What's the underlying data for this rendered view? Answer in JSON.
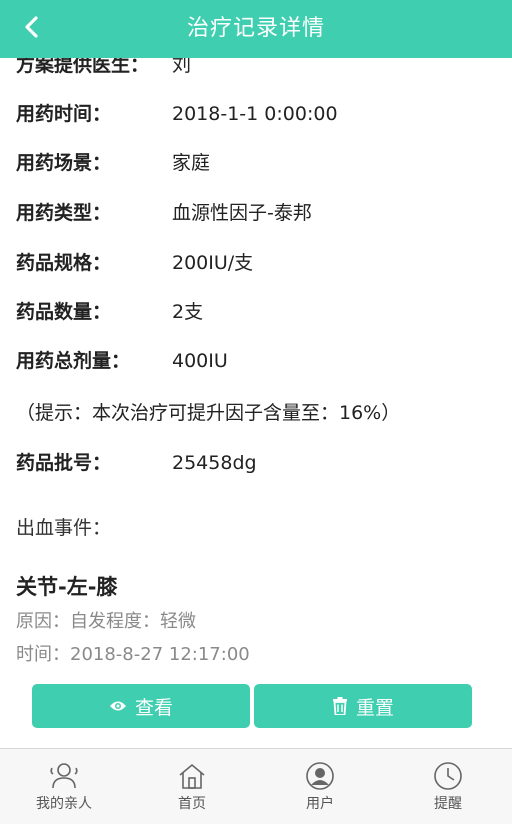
{
  "header": {
    "title": "治疗记录详情",
    "back_icon": "chevron-left-icon"
  },
  "details": {
    "doctor": {
      "label": "方案提供医生：",
      "value": "刘"
    },
    "time": {
      "label": "用药时间：",
      "value": "2018-1-1 0:00:00"
    },
    "scene": {
      "label": "用药场景：",
      "value": "家庭"
    },
    "type": {
      "label": "用药类型：",
      "value": "血源性因子-泰邦"
    },
    "spec": {
      "label": "药品规格：",
      "value": "200IU/支"
    },
    "quantity": {
      "label": "药品数量：",
      "value": "2支"
    },
    "total": {
      "label": "用药总剂量：",
      "value": "400IU"
    },
    "tip": "（提示：本次治疗可提升因子含量至：16%）",
    "batch": {
      "label": "药品批号：",
      "value": "25458dg"
    }
  },
  "bleeding": {
    "title": "出血事件：",
    "card": {
      "location": "关节-左-膝",
      "reason": "原因：自发程度：轻微",
      "time": "时间：2018-8-27 12:17:00",
      "view_label": "查看",
      "reset_label": "重置"
    }
  },
  "tabbar": {
    "items": [
      {
        "label": "我的亲人",
        "icon": "family-icon"
      },
      {
        "label": "首页",
        "icon": "home-icon"
      },
      {
        "label": "用户",
        "icon": "user-icon"
      },
      {
        "label": "提醒",
        "icon": "clock-icon"
      }
    ]
  },
  "colors": {
    "accent": "#3fcfb0",
    "tabbar_bg": "#f7f7f7"
  }
}
